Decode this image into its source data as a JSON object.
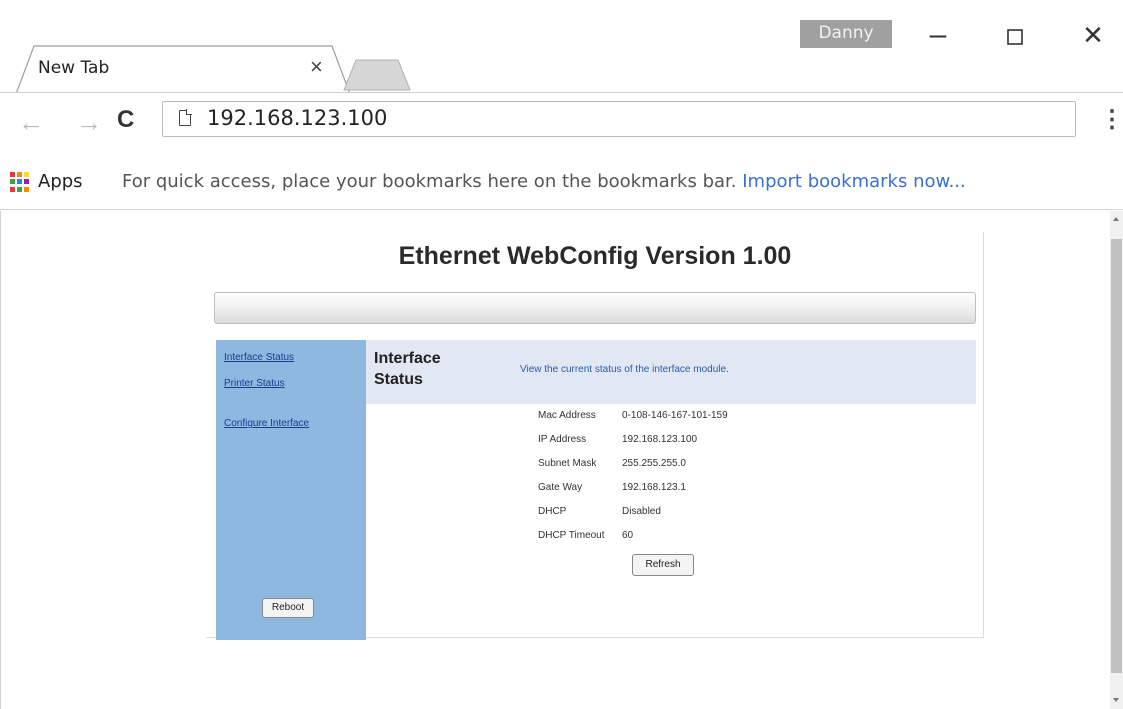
{
  "browser": {
    "tab_title": "New Tab",
    "tab_close": "×",
    "profile_name": "Danny",
    "window_min": "–",
    "window_max": "☐",
    "window_close": "✕",
    "nav_back": "←",
    "nav_forward": "→",
    "nav_reload": "C",
    "url": "192.168.123.100",
    "menu": "⋮"
  },
  "bookmarks_bar": {
    "apps_label": "Apps",
    "hint": "For quick access, place your bookmarks here on the bookmarks bar.",
    "import_link": "Import bookmarks now..."
  },
  "webconfig": {
    "title": "Ethernet WebConfig Version 1.00",
    "nav": {
      "interface_status": "Interface Status",
      "printer_status": "Printer Status",
      "configure_interface": "Configure Interface",
      "reboot": "Reboot"
    },
    "header": {
      "title": "Interface Status",
      "description": "View the current status of the interface module."
    },
    "status": [
      {
        "label": "Mac Address",
        "value": "0-108-146-167-101-159"
      },
      {
        "label": "IP Address",
        "value": "192.168.123.100"
      },
      {
        "label": "Subnet Mask",
        "value": "255.255.255.0"
      },
      {
        "label": "Gate Way",
        "value": "192.168.123.1"
      },
      {
        "label": "DHCP",
        "value": "Disabled"
      },
      {
        "label": "DHCP Timeout",
        "value": "60"
      }
    ],
    "refresh_label": "Refresh"
  },
  "colors": {
    "apps_grid": [
      "#e53935",
      "#fb8c00",
      "#fdd835",
      "#43a047",
      "#1e88e5",
      "#8e24aa",
      "#e53935",
      "#43a047",
      "#fb8c00"
    ],
    "nav_panel": "#8fb8e0",
    "header_band": "#e1e8f4",
    "link": "#3b6fd6"
  }
}
